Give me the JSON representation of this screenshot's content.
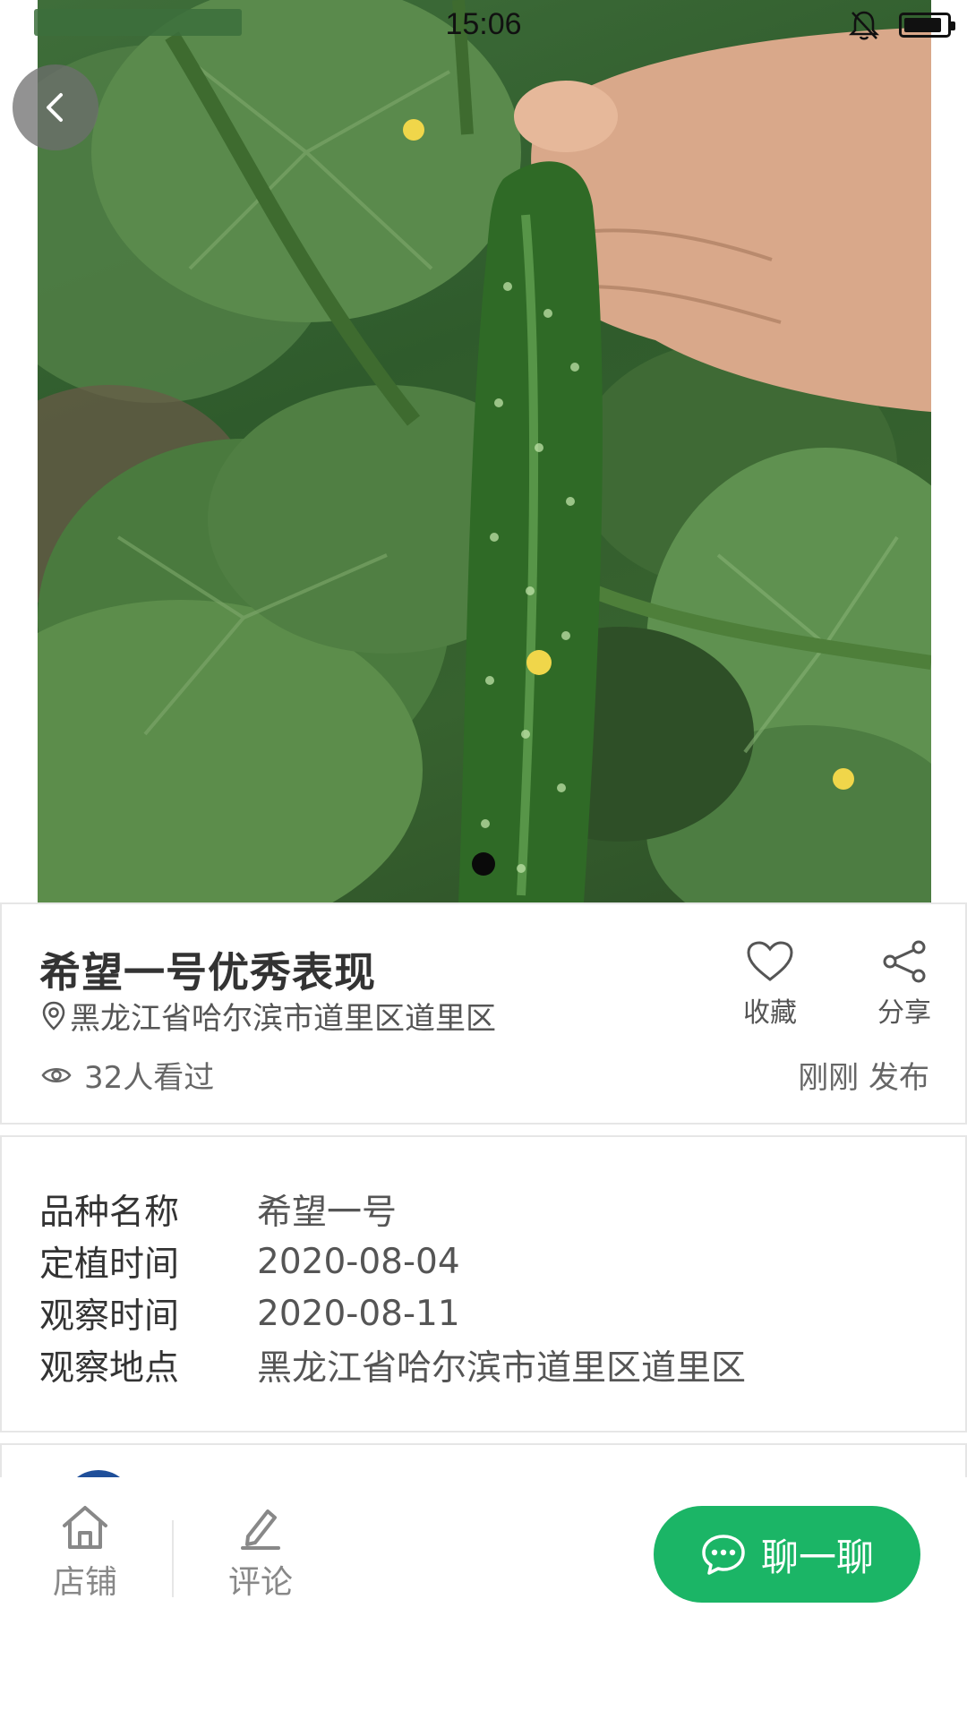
{
  "status_bar": {
    "time": "15:06",
    "battery_level": 0.9
  },
  "post": {
    "title": "希望一号优秀表现",
    "location": "黑龙江省哈尔滨市道里区道里区",
    "views": "32人看过",
    "publish_time": "刚刚 发布",
    "favorite_label": "收藏",
    "share_label": "分享"
  },
  "carousel": {
    "total": 1,
    "current": 1
  },
  "info": {
    "rows": [
      {
        "key": "品种名称",
        "value": "希望一号"
      },
      {
        "key": "定植时间",
        "value": "2020-08-04"
      },
      {
        "key": "观察时间",
        "value": "2020-08-11"
      },
      {
        "key": "观察地点",
        "value": "黑龙江省哈尔滨市道里区道里区"
      }
    ]
  },
  "bottom_bar": {
    "shop_label": "店铺",
    "comment_label": "评论",
    "chat_label": "聊一聊"
  },
  "colors": {
    "accent": "#1bb566",
    "title": "#333333",
    "muted": "#888888"
  },
  "icons": {
    "back": "chevron-left-icon",
    "location": "location-pin-icon",
    "views": "eye-icon",
    "favorite": "heart-icon",
    "share": "share-icon",
    "shop": "home-icon",
    "comment": "pencil-icon",
    "chat": "chat-bubble-icon"
  }
}
